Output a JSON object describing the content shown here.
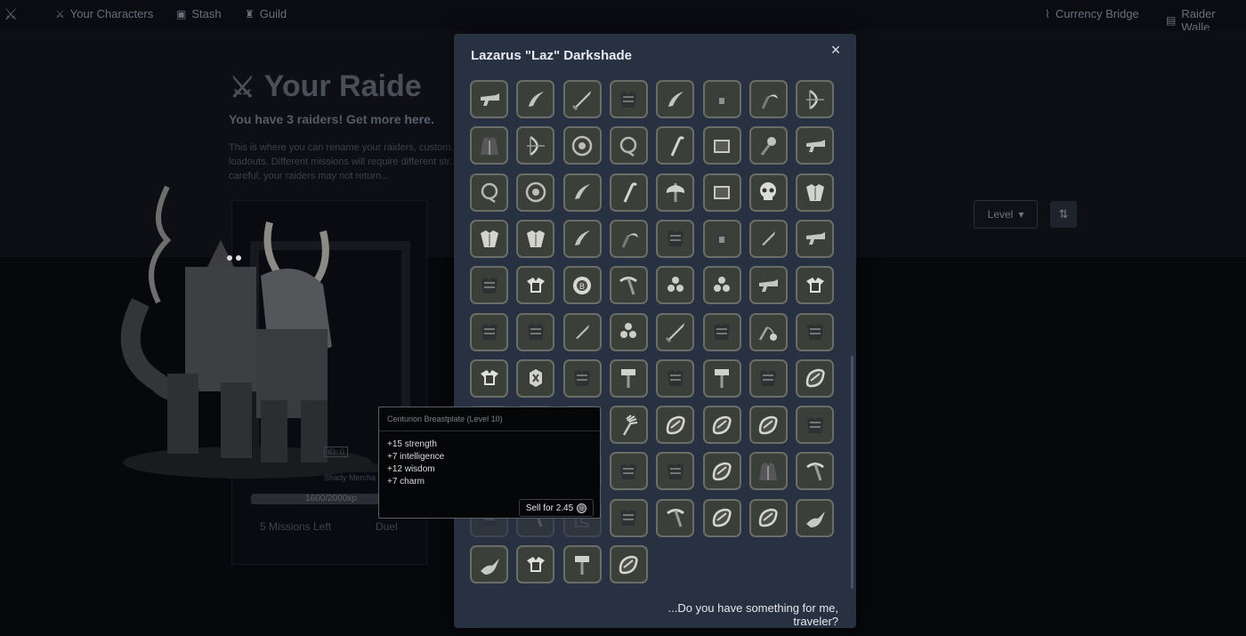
{
  "nav": {
    "items": [
      {
        "label": "Your Characters",
        "icon": "sword-icon"
      },
      {
        "label": "Stash",
        "icon": "chest-icon"
      },
      {
        "label": "Guild",
        "icon": "castle-icon"
      }
    ],
    "right_items": [
      {
        "label": "Currency Bridge",
        "icon": "bridge-icon"
      },
      {
        "label": "Raider Walle",
        "icon": "wallet-icon"
      }
    ]
  },
  "page": {
    "title": "Your Raide",
    "subtitle_prefix": "You have 3 raiders! Get more ",
    "subtitle_link": "here.",
    "description": "This is where you can rename your raiders, custom... loadouts. Different missions will require different str... careful, your raiders may not return...",
    "level_select": "Level",
    "xp": "1600/2000xp",
    "missions_left": "5 Missions Left",
    "duel": "Duel",
    "merchant": "Shady Mercha",
    "tag": "ID: 0"
  },
  "modal": {
    "title": "Lazarus \"Laz\" Darkshade",
    "footer": "...Do you have something for me, traveler?",
    "items": [
      "blunderbuss",
      "sickle-blade",
      "sword",
      "chestplate",
      "sickle-blade",
      "hood-armor",
      "scythe",
      "bow",
      "robe",
      "bow",
      "round-shield",
      "whip",
      "cane",
      "tome",
      "mace",
      "blunderbuss",
      "whip",
      "round-shield",
      "sickle-blade",
      "cane",
      "axe",
      "tome",
      "skull",
      "plate-armor",
      "plate-armor",
      "plate-armor",
      "sickle-blade",
      "scythe",
      "chestplate",
      "hood-armor",
      "dagger",
      "blunderbuss",
      "chestplate",
      "breastplate",
      "rune-shield",
      "pickaxe",
      "tri-orb",
      "tri-orb",
      "blunderbuss",
      "breastplate",
      "chestplate",
      "chestplate",
      "dagger",
      "tri-orb",
      "sword",
      "chestplate",
      "flail",
      "chestplate",
      "breastplate",
      "rune-stone",
      "chestplate",
      "hammer",
      "chestplate",
      "hammer",
      "chestplate",
      "wrapping",
      "hand",
      "hand",
      "hand",
      "rake",
      "wrapping",
      "wrapping",
      "wrapping",
      "chestplate",
      "hand",
      "hand",
      "hand",
      "chestplate",
      "chestplate",
      "wrapping",
      "robe",
      "pickaxe",
      "chestplate",
      "pickaxe",
      "boots",
      "chestplate",
      "pickaxe",
      "wrapping",
      "wrapping",
      "bird",
      "bird",
      "breastplate",
      "hammer",
      "wrapping"
    ]
  },
  "tooltip": {
    "title": "Centurion Breastplate (Level 10)",
    "stats": [
      "+15 strength",
      "+7 intelligence",
      "+12 wisdom",
      "+7 charm"
    ],
    "sell": "Sell for 2.45"
  },
  "colors": {
    "modal_bg": "#283141",
    "slot_border": "#6b6e66",
    "slot_bg": "#3a3f3a"
  }
}
